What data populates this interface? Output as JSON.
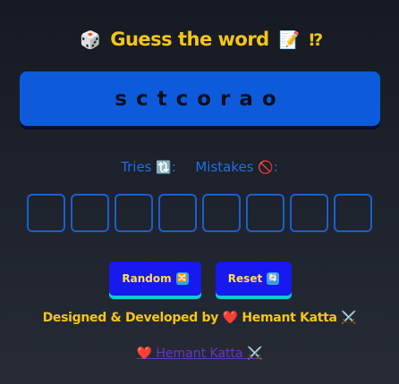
{
  "header": {
    "dice_emoji": "🎲",
    "title": "Guess the word",
    "memo_emoji": "📝",
    "punct": "⁉"
  },
  "word": {
    "scrambled": "sctcorao"
  },
  "stats": {
    "tries_label": "Tries",
    "tries_icon": "🔃",
    "tries_colon": ":",
    "mistakes_label": "Mistakes",
    "mistakes_icon": "🚫",
    "mistakes_colon": ":"
  },
  "slots_count": 8,
  "buttons": {
    "random_label": "Random",
    "random_icon": "🔀",
    "reset_label": "Reset",
    "reset_icon": "🔄"
  },
  "credit": {
    "prefix": "Designed & Developed by",
    "heart": "❤️",
    "name": "Hemant Katta",
    "swords": "⚔️"
  },
  "footer_link": {
    "heart": "❤️",
    "name": "Hemant Katta",
    "swords": "⚔️"
  }
}
